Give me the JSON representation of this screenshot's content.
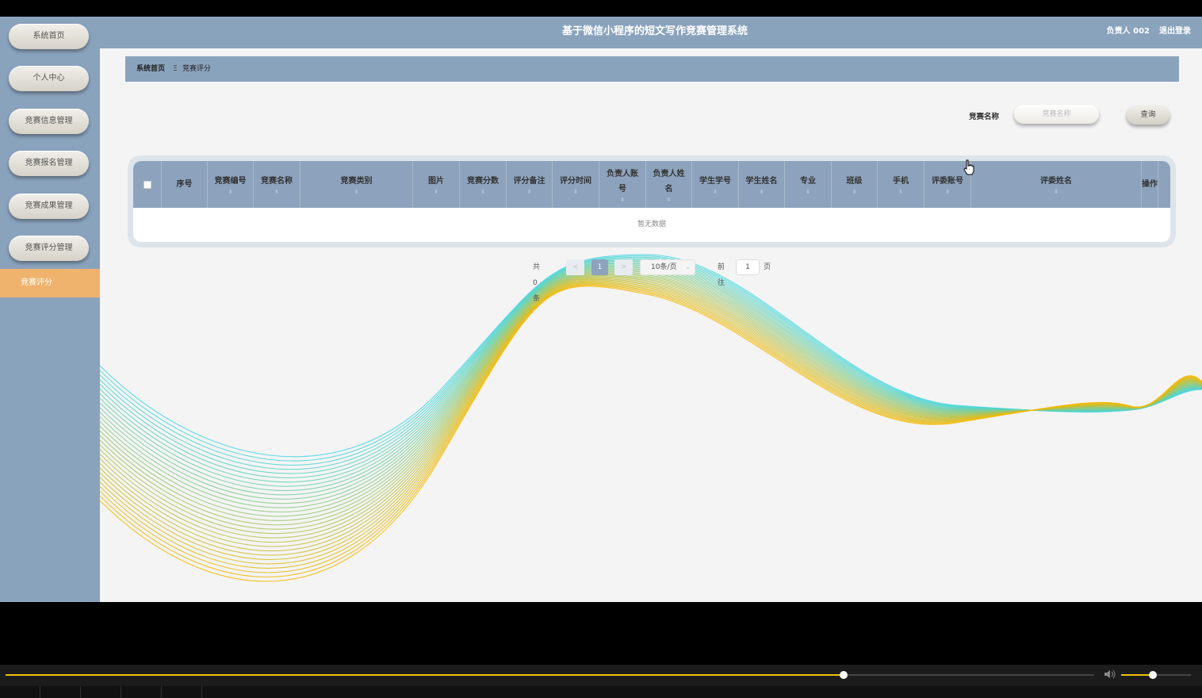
{
  "header": {
    "title": "基于微信小程序的短文写作竞赛管理系统",
    "user": "负责人 002",
    "logout": "退出登录"
  },
  "sidebar": {
    "items": [
      {
        "label": "系统首页"
      },
      {
        "label": "个人中心"
      },
      {
        "label": "竞赛信息管理"
      },
      {
        "label": "竞赛报名管理"
      },
      {
        "label": "竞赛成果管理"
      },
      {
        "label": "竞赛评分管理"
      }
    ],
    "active_sub": "竞赛评分"
  },
  "breadcrumb": {
    "home": "系统首页",
    "separator": "Ξ",
    "current": "竞赛评分"
  },
  "search": {
    "label": "竞赛名称",
    "placeholder": "竞赛名称",
    "button": "查询"
  },
  "table": {
    "columns": [
      {
        "lines": [
          "序号"
        ]
      },
      {
        "lines": [
          "竞赛编号"
        ]
      },
      {
        "lines": [
          "竞赛名称"
        ]
      },
      {
        "lines": [
          "竞赛类别"
        ]
      },
      {
        "lines": [
          "图片"
        ]
      },
      {
        "lines": [
          "竞赛分数"
        ]
      },
      {
        "lines": [
          "评分备注"
        ]
      },
      {
        "lines": [
          "评分时间"
        ]
      },
      {
        "lines": [
          "负责人账",
          "号"
        ]
      },
      {
        "lines": [
          "负责人姓",
          "名"
        ]
      },
      {
        "lines": [
          "学生学号"
        ]
      },
      {
        "lines": [
          "学生姓名"
        ]
      },
      {
        "lines": [
          "专业"
        ]
      },
      {
        "lines": [
          "班级"
        ]
      },
      {
        "lines": [
          "手机"
        ]
      },
      {
        "lines": [
          "评委账号"
        ]
      },
      {
        "lines": [
          "评委姓名"
        ]
      },
      {
        "lines": [
          "操作"
        ]
      }
    ],
    "empty_text": "暂无数据"
  },
  "pagination": {
    "total": "共 0 条",
    "prev": "<",
    "current": "1",
    "next": ">",
    "page_size": "10条/页",
    "goto_label": "前往",
    "goto_value": "1",
    "goto_suffix": "页"
  },
  "player": {
    "progress": 0.77,
    "volume": 0.45
  },
  "colors": {
    "primary": "#8aa3bd",
    "active": "#efb36e",
    "wave_cyan": "#3fd6e0",
    "wave_yellow": "#f5b800"
  }
}
